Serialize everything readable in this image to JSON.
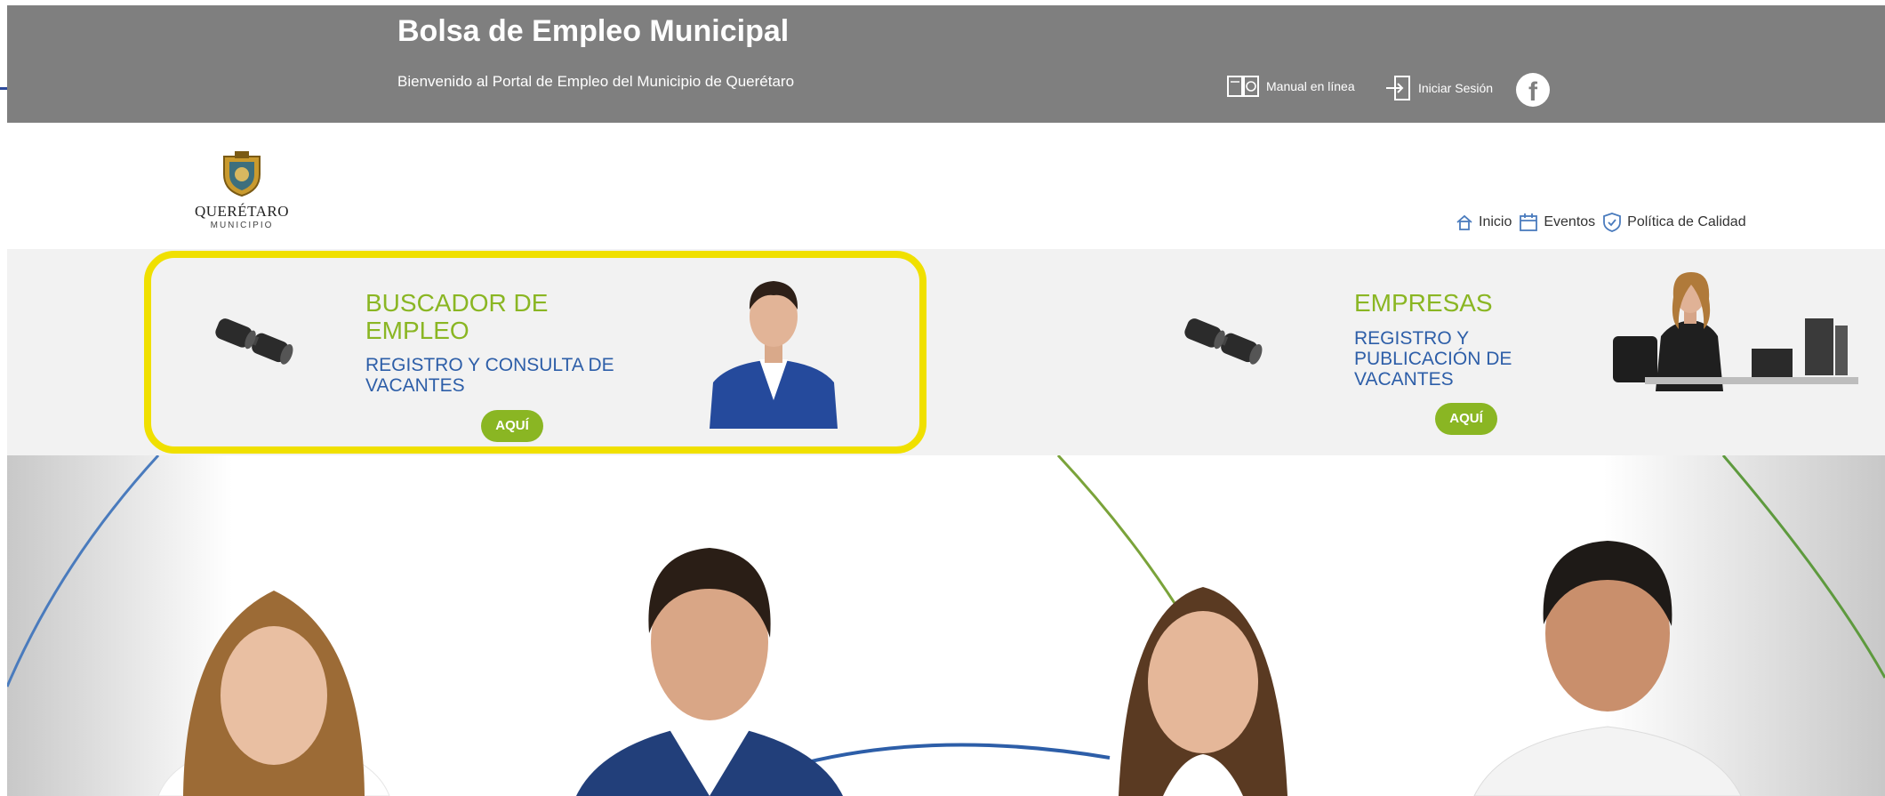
{
  "header": {
    "title": "Bolsa de Empleo Municipal",
    "subtitle": "Bienvenido al Portal de Empleo del Municipio de Querétaro",
    "manual_label": "Manual en línea",
    "login_label": "Iniciar Sesión",
    "facebook_glyph": "f",
    "bg_color": "#7f7f7f"
  },
  "logo": {
    "name": "QUERÉTARO",
    "sub": "MUNICIPIO"
  },
  "nav": {
    "items": [
      {
        "label": "Inicio",
        "icon": "home-icon"
      },
      {
        "label": "Eventos",
        "icon": "calendar-icon"
      },
      {
        "label": "Política de Calidad",
        "icon": "shield-icon"
      }
    ]
  },
  "cards": {
    "jobseeker": {
      "title_line1": "BUSCADOR DE",
      "title_line2": "EMPLEO",
      "sub_line1": "REGISTRO Y CONSULTA DE",
      "sub_line2": "VACANTES",
      "button": "AQUÍ"
    },
    "company": {
      "title": "EMPRESAS",
      "sub_line1": "REGISTRO Y",
      "sub_line2": "PUBLICACIÓN DE",
      "sub_line3": "VACANTES",
      "button": "AQUÍ"
    }
  },
  "colors": {
    "accent_green": "#8ab623",
    "accent_blue": "#2d5ea8",
    "highlight_yellow": "#f0e000"
  }
}
